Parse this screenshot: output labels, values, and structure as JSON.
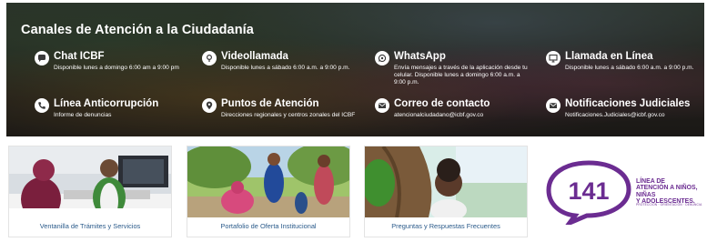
{
  "banner": {
    "title": "Canales de Atención a la Ciudadanía",
    "channels": [
      {
        "title": "Chat ICBF",
        "desc": "Disponible lunes a domingo 6:00 am a 9:00 pm",
        "icon": "chat-icon"
      },
      {
        "title": "Videollamada",
        "desc": "Disponible lunes a sábado 6:00 a.m. a 9:00 p.m.",
        "icon": "video-call-icon"
      },
      {
        "title": "WhatsApp",
        "desc": "Envía mensajes a través de la aplicación desde tu celular. Disponible lunes a domingo 6:00 a.m. a 9:00 p.m.",
        "icon": "whatsapp-icon"
      },
      {
        "title": "Llamada en Línea",
        "desc": "Disponible lunes a sábado 6:00 a.m. a 9:00 p.m.",
        "icon": "online-call-icon"
      },
      {
        "title": "Línea Anticorrupción",
        "desc": "Informe de denuncias",
        "icon": "phone-icon"
      },
      {
        "title": "Puntos de Atención",
        "desc": "Direcciones regionales y centros zonales del ICBF",
        "icon": "location-pin-icon"
      },
      {
        "title": "Correo de contacto",
        "desc": "atencionalciudadano@icbf.gov.co",
        "icon": "mail-icon"
      },
      {
        "title": "Notificaciones Judiciales",
        "desc": "Notificaciones.Judiciales@icbf.gov.co",
        "icon": "mail-icon"
      }
    ]
  },
  "cards": [
    {
      "label": "Ventanilla de Trámites y Servicios"
    },
    {
      "label": "Portafolio de Oferta Institucional"
    },
    {
      "label": "Preguntas y Respuestas Frecuentes"
    }
  ],
  "logo": {
    "number": "141",
    "lines": [
      "LÍNEA DE",
      "ATENCIÓN A NIÑOS, NIÑAS",
      "Y ADOLESCENTES."
    ],
    "tagline": "PROTECCIÓN · ORIENTACIÓN · DENUNCIA"
  },
  "colors": {
    "logo_purple": "#6b2c91",
    "card_label_blue": "#2a5a8a"
  }
}
